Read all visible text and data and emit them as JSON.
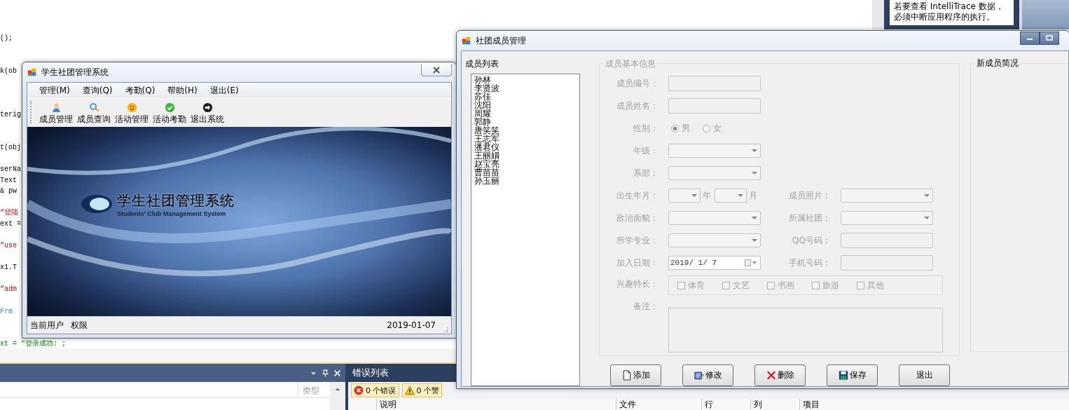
{
  "editor": {
    "lines": [
      {
        "text": "();",
        "kind": "code"
      },
      {
        "text": "k(ob",
        "kind": "code"
      },
      {
        "text": "terig",
        "kind": "code"
      },
      {
        "text": "t(obj",
        "kind": "code"
      },
      {
        "text": "serNa",
        "kind": "code"
      },
      {
        "text": "Text",
        "kind": "code"
      },
      {
        "text": "& pw",
        "kind": "code"
      },
      {
        "text": "“登陆",
        "kind": "string"
      },
      {
        "text": "ext =",
        "kind": "code"
      },
      {
        "text": "“use",
        "kind": "string"
      },
      {
        "text": "x1.T",
        "kind": "code"
      },
      {
        "text": "“adm",
        "kind": "string"
      },
      {
        "text": "Frm",
        "kind": "type"
      },
      {
        "text": "xt = “登录成功: ;",
        "kind": "comment"
      }
    ]
  },
  "tooltip": {
    "lines": [
      "若要查看 IntelliTrace 数据，",
      "必须中断应用程序的执行。"
    ]
  },
  "main_window": {
    "title": "学生社团管理系统",
    "menu": [
      "管理(M)",
      "查询(Q)",
      "考勤(Q)",
      "帮助(H)",
      "退出(E)"
    ],
    "toolbar": [
      {
        "label": "成员管理",
        "kind": "member"
      },
      {
        "label": "成员查询",
        "kind": "search"
      },
      {
        "label": "活动管理",
        "kind": "activity"
      },
      {
        "label": "活动考勤",
        "kind": "check"
      },
      {
        "label": "退出系统",
        "kind": "exit"
      }
    ],
    "banner": {
      "title": "学生社团管理系统",
      "subtitle": "Students' Club Management System"
    },
    "status_bar": {
      "user": "当前用户",
      "role": "权限",
      "date": "2019-01-07"
    }
  },
  "member_window": {
    "title": "社团成员管理",
    "list_title": "成员列表",
    "members": [
      "孙林",
      "李贤波",
      "苏佳",
      "沈阳",
      "周耀",
      "郭静",
      "唐笑笑",
      "王志军",
      "潘君仪",
      "王丽娟",
      "赵宝亮",
      "曹苗苗",
      "孙玉丽"
    ],
    "info_group": {
      "title": "成员基本信息",
      "disabled": true,
      "fields": [
        {
          "label": "成员编号：",
          "kind": "text"
        },
        {
          "label": "成员姓名：",
          "kind": "text"
        },
        {
          "label": "性别：",
          "kind": "radio",
          "options": [
            {
              "label": "男",
              "selected": true
            },
            {
              "label": "女",
              "selected": false
            }
          ]
        },
        {
          "label": "年级：",
          "kind": "combo"
        },
        {
          "label": "系部：",
          "kind": "combo"
        },
        {
          "label": "出生年月：",
          "kind": "month",
          "units": [
            "年",
            "月"
          ]
        },
        {
          "label": "政治面貌：",
          "kind": "combo"
        },
        {
          "label": "所学专业：",
          "kind": "combo"
        },
        {
          "label": "加入日期：",
          "kind": "date",
          "value": "2019/ 1/ 7"
        },
        {
          "label": "兴趣特长：",
          "kind": "checks",
          "options": [
            {
              "label": "体育",
              "checked": false
            },
            {
              "label": "文艺",
              "checked": false
            },
            {
              "label": "书画",
              "checked": false
            },
            {
              "label": "旅游",
              "checked": false
            },
            {
              "label": "其他",
              "checked": false
            }
          ]
        },
        {
          "label": "备注：",
          "kind": "textarea"
        }
      ],
      "side_fields": [
        {
          "label": "成员照片：",
          "kind": "combo"
        },
        {
          "label": "所属社团：",
          "kind": "combo"
        },
        {
          "label": "QQ号码：",
          "kind": "text"
        },
        {
          "label": "手机号码：",
          "kind": "text"
        }
      ]
    },
    "summary_title": "新成员简况",
    "buttons": [
      {
        "label": "添加",
        "kind": "new"
      },
      {
        "label": "修改",
        "kind": "edit"
      },
      {
        "label": "删除",
        "kind": "delete"
      },
      {
        "label": "保存",
        "kind": "save"
      },
      {
        "label": "退出",
        "kind": "plain"
      }
    ]
  },
  "ide": {
    "output_panel": {
      "column": "类型"
    },
    "error_list": {
      "title": "错误列表",
      "filters": [
        {
          "kind": "error",
          "label": "0 个错误",
          "selected": true
        },
        {
          "kind": "warning",
          "label": "0 个警",
          "selected": true
        }
      ],
      "columns": [
        "说明",
        "文件",
        "行",
        "列",
        "项目"
      ]
    }
  }
}
